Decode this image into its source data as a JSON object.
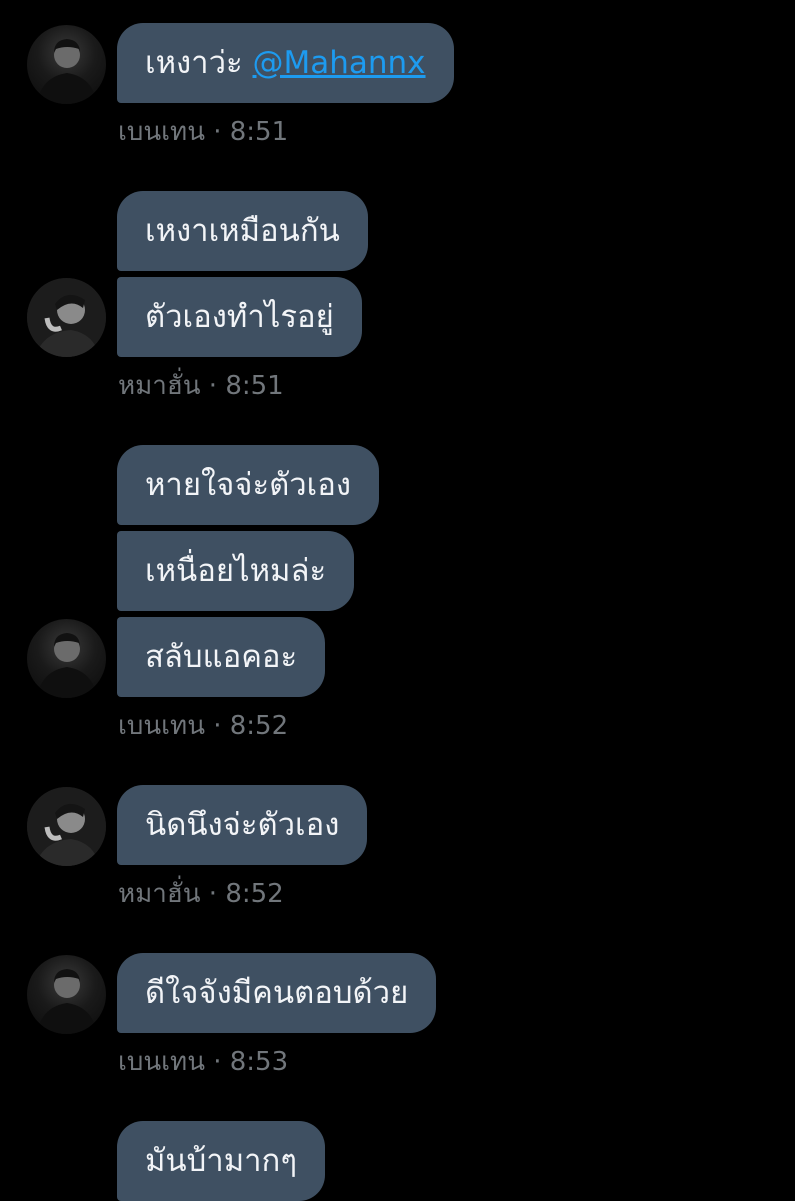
{
  "messages": [
    {
      "text_before": "เหงาว่ะ ",
      "mention": "@Mahannx"
    },
    {
      "text": "เหงาเหมือนกัน"
    },
    {
      "text": "ตัวเองทำไรอยู่"
    },
    {
      "text": "หายใจจ่ะตัวเอง"
    },
    {
      "text": "เหนื่อยไหมล่ะ"
    },
    {
      "text": "สลับแอคอะ"
    },
    {
      "text": "นิดนึงจ่ะตัวเอง"
    },
    {
      "text": "ดีใจจังมีคนตอบด้วย"
    },
    {
      "text": "มันบ้ามากๆ"
    }
  ],
  "meta": [
    {
      "text": "เบนเทน · 8:51"
    },
    {
      "text": "หมาฮั่น · 8:51"
    },
    {
      "text": "เบนเทน · 8:52"
    },
    {
      "text": "หมาฮั่น · 8:52"
    },
    {
      "text": "เบนเทน · 8:53"
    }
  ],
  "avatars": [
    "person-photo-icon",
    "person-photo-icon",
    "person-photo-icon",
    "person-photo-icon",
    "person-photo-icon"
  ],
  "colors": {
    "background": "#000000",
    "bubble": "#3f5062",
    "bubble_text": "#f2f4f7",
    "mention": "#1d9bf0",
    "meta_text": "#71767b"
  }
}
